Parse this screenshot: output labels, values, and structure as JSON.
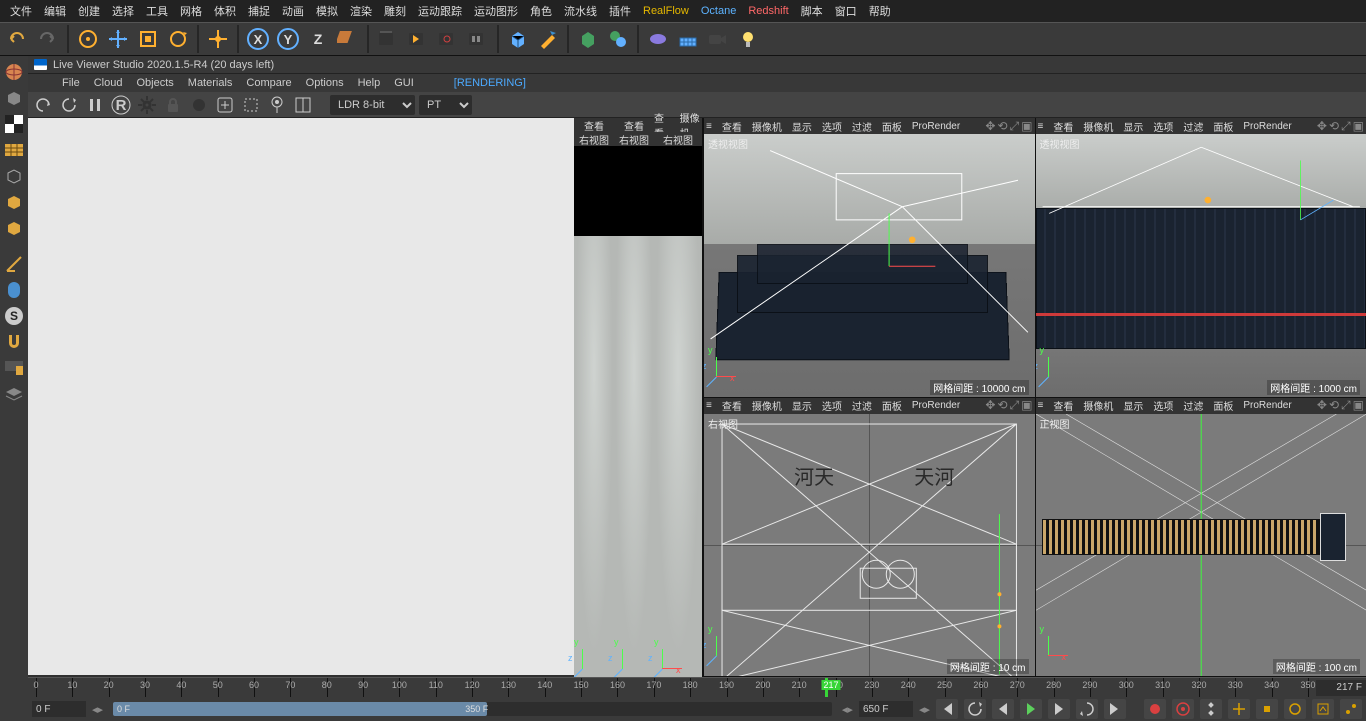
{
  "menu": [
    "文件",
    "编辑",
    "创建",
    "选择",
    "工具",
    "网格",
    "体积",
    "捕捉",
    "动画",
    "模拟",
    "渲染",
    "雕刻",
    "运动跟踪",
    "运动图形",
    "角色",
    "流水线",
    "插件",
    "RealFlow",
    "Octane",
    "Redshift",
    "脚本",
    "窗口",
    "帮助"
  ],
  "menu_highlight": {
    "17": "hl1",
    "18": "hl2",
    "19": "hl3"
  },
  "panel": {
    "title": "Live Viewer Studio 2020.1.5-R4 (20 days left)"
  },
  "sub_menu": [
    "File",
    "Cloud",
    "Objects",
    "Materials",
    "Compare",
    "Options",
    "Help",
    "GUI",
    "[RENDERING]"
  ],
  "sub_toolbar": {
    "mode": "LDR 8-bit",
    "engine": "PT"
  },
  "viewport_menu": [
    "查看",
    "摄像机",
    "显示",
    "选项",
    "过滤",
    "面板",
    "ProRender"
  ],
  "thumb_menu": [
    "查看",
    "摄像机"
  ],
  "thumb_label": "右视图",
  "viewports": {
    "tl": {
      "label": "透视视图",
      "status": "网格间距 : 10000 cm"
    },
    "tr": {
      "label": "透视视图",
      "status": "网格间距 : 1000 cm"
    },
    "bl": {
      "label": "右视图",
      "status": "网格间距 : 10 cm",
      "text1": "河天",
      "text2": "天河"
    },
    "br": {
      "label": "正视图",
      "status": "网格间距 : 100 cm"
    }
  },
  "timeline": {
    "start": 0,
    "end": 350,
    "ticks": [
      0,
      10,
      20,
      30,
      40,
      50,
      60,
      70,
      80,
      90,
      100,
      110,
      120,
      130,
      140,
      150,
      160,
      170,
      180,
      190,
      200,
      210,
      220,
      230,
      240,
      250,
      260,
      270,
      280,
      290,
      300,
      310,
      320,
      330,
      340,
      350
    ],
    "current": 217,
    "current_label": "217",
    "current_frame_label": "217 F"
  },
  "transport": {
    "left_box": "0 F",
    "range_left": "0 F",
    "range_mark": "350 F",
    "right_box": "650 F"
  },
  "axis": {
    "x": "x",
    "y": "y",
    "z": "z"
  }
}
